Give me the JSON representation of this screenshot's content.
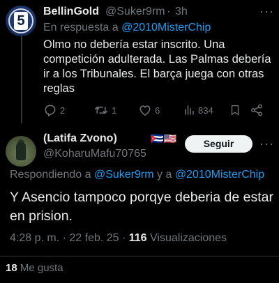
{
  "reply_tweet": {
    "author_name": "BellinGold",
    "author_handle": "@Suker9rm",
    "separator": "·",
    "time": "3h",
    "more_icon": "more-horizontal-icon",
    "in_reply_prefix": "En respuesta a ",
    "in_reply_mention": "@2010MisterChip",
    "text": "Olmo no debería estar inscrito. Una competición adulterada. Las Palmas debería ir a los Tribunales. El barça juega con otras reglas",
    "actions": {
      "reply_count": "2",
      "retweet_count": "1",
      "like_count": "6",
      "views_count": "834"
    }
  },
  "main_tweet": {
    "author_name": "(Latifa Zvono)",
    "author_flags": "🇨🇺🇺🇸",
    "author_handle": "@KoharuMafu70765",
    "follow_label": "Seguir",
    "replying_prefix": "Respondiendo a ",
    "replying_mention1": "@Suker9rm",
    "replying_and": " y a ",
    "replying_mention2": "@2010MisterChip",
    "text": "Y Asencio tampoco porqye deberia de estar en prision.",
    "time": "4:28 p. m.",
    "date_separator": " · ",
    "date": "22 feb. 25",
    "views_separator": " · ",
    "views_count": "116",
    "views_label": " Visualizaciones",
    "likes_count": "18",
    "likes_label": " Me gusta"
  },
  "colors": {
    "background": "#000000",
    "text": "#e7e9ea",
    "muted": "#71767b",
    "accent": "#1d9bf0",
    "button_bg": "#eff3f4"
  }
}
